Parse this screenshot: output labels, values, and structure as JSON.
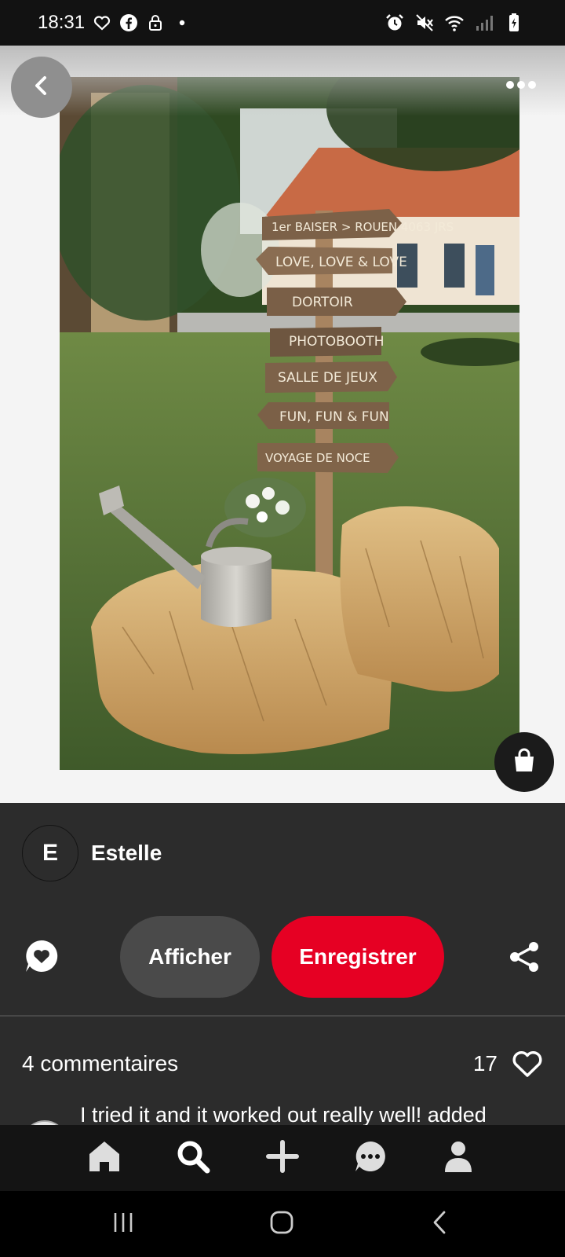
{
  "status_bar": {
    "time": "18:31",
    "left_icons": [
      "heart-outline-icon",
      "facebook-icon",
      "lock-icon",
      "dot-icon"
    ],
    "right_icons": [
      "alarm-icon",
      "mute-icon",
      "wifi-icon",
      "signal-icon",
      "battery-charging-icon"
    ]
  },
  "pin": {
    "image_description": "wooden signpost with hay bales and watering can",
    "sign_texts": [
      "1er BAISER > ROUEN 4063 JRS",
      "LOVE, LOVE & LOVE",
      "DORTOIR",
      "PHOTOBOOTH",
      "SALLE DE JEUX",
      "FUN, FUN & FUN",
      "VOYAGE DE NOCE"
    ],
    "back_icon": "chevron-left-icon",
    "more_icon": "more-horizontal-icon",
    "shop_icon": "shopping-bag-icon"
  },
  "creator": {
    "initial": "E",
    "name": "Estelle"
  },
  "actions": {
    "comment_icon": "comment-heart-icon",
    "view_label": "Afficher",
    "save_label": "Enregistrer",
    "share_icon": "share-icon"
  },
  "engagement": {
    "comments_label": "4 commentaires",
    "likes_count": "17",
    "heart_icon": "heart-outline-icon"
  },
  "comment_preview": {
    "text": "I tried it and it worked out really well! added"
  },
  "bottom_nav": [
    "home-icon",
    "search-icon",
    "plus-icon",
    "messages-icon",
    "profile-icon"
  ],
  "system_nav": [
    "recent-apps-icon",
    "home-button-icon",
    "back-icon"
  ],
  "colors": {
    "accent": "#e60023",
    "panel": "#2c2c2c",
    "nav": "#141414"
  }
}
